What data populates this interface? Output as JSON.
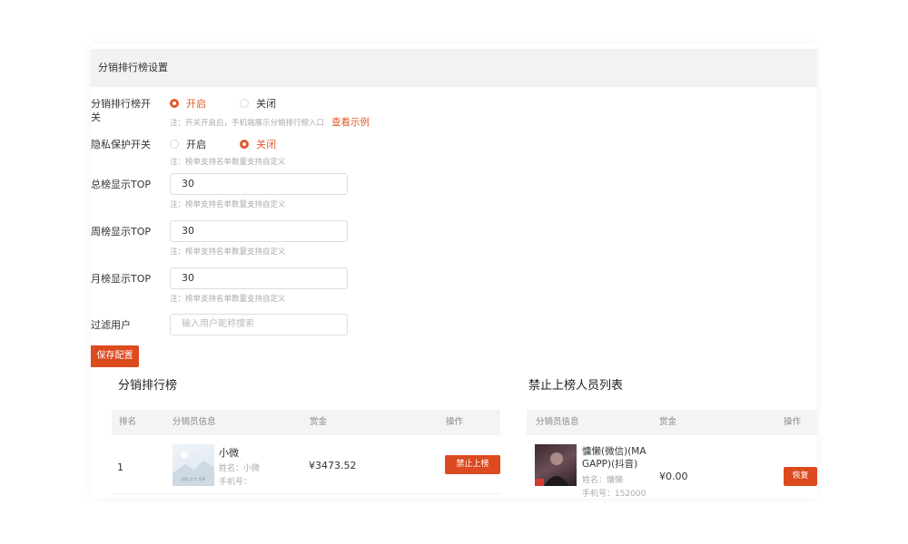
{
  "section": {
    "title": "分销排行榜设置"
  },
  "settings": {
    "ranking_switch": {
      "label": "分销排行榜开关",
      "on": "开启",
      "off": "关闭",
      "selected": "on",
      "note": "注：开关开启后，手机端展示分销排行榜入口",
      "link": "查看示例"
    },
    "privacy_switch": {
      "label": "隐私保护开关",
      "on": "开启",
      "off": "关闭",
      "selected": "off",
      "note": "注：榜单支持名单数量支持自定义"
    },
    "total_top": {
      "label": "总榜显示TOP",
      "value": "30",
      "note": "注：榜单支持名单数量支持自定义"
    },
    "week_top": {
      "label": "周榜显示TOP",
      "value": "30",
      "note": "注：榜单支持名单数量支持自定义"
    },
    "month_top": {
      "label": "月榜显示TOP",
      "value": "30",
      "note": "注：榜单支持名单数量支持自定义"
    },
    "filter_users": {
      "label": "过滤用户",
      "placeholder": "输入用户昵称搜索"
    },
    "save_label": "保存配置"
  },
  "ranking": {
    "title": "分销排行榜",
    "columns": [
      "排名",
      "分销员信息",
      "赏金",
      "操作"
    ],
    "rows": [
      {
        "rank": "1",
        "nickname": "小微",
        "name": "姓名：小微",
        "phone": "手机号：",
        "reward": "¥3473.52",
        "action": "禁止上榜",
        "thumb_text": "简约 文字 风景"
      }
    ]
  },
  "banned": {
    "title": "禁止上榜人员列表",
    "columns": [
      "分销员信息",
      "赏金",
      "操作"
    ],
    "rows": [
      {
        "nickname_line1": "慵懒(微信)(MA",
        "nickname_line2": "GAPP)(抖音)",
        "name": "姓名：慵懒",
        "phone": "手机号：152000",
        "reward": "¥0.00",
        "action": "恢复"
      }
    ]
  },
  "colors": {
    "accent": "#dc4a1f",
    "header_bg": "#f3f2f2"
  }
}
